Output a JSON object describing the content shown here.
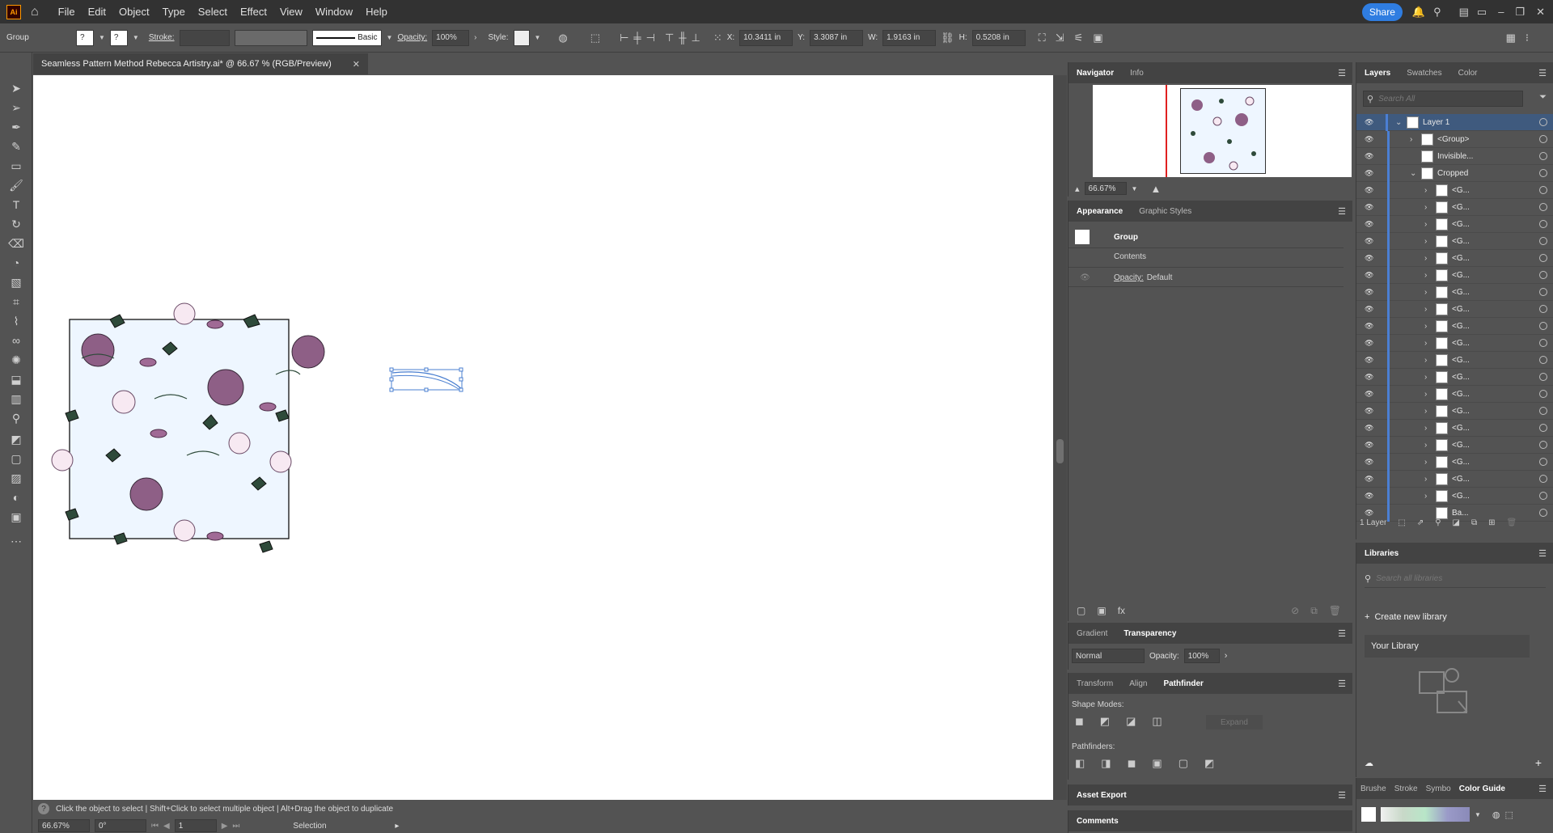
{
  "app": {
    "logo": "Ai",
    "accent": "#2f7de1",
    "logo_color": "#ff9a00",
    "logo_bg": "#330000"
  },
  "menu": [
    "File",
    "Edit",
    "Object",
    "Type",
    "Select",
    "Effect",
    "View",
    "Window",
    "Help"
  ],
  "top_right": {
    "share": "Share"
  },
  "control": {
    "selection_type": "Group",
    "stroke_label": "Stroke:",
    "brush_label": "Basic",
    "opacity_label": "Opacity:",
    "opacity_value": "100%",
    "style_label": "Style:",
    "x_label": "X:",
    "x_value": "10.3411 in",
    "y_label": "Y:",
    "y_value": "3.3087 in",
    "w_label": "W:",
    "w_value": "1.9163 in",
    "h_label": "H:",
    "h_value": "0.5208 in"
  },
  "document": {
    "tab_title": "Seamless Pattern Method Rebecca Artistry.ai* @ 66.67 % (RGB/Preview)"
  },
  "status": {
    "hint": "Click the object to select  |  Shift+Click to select multiple object  |  Alt+Drag the object to duplicate",
    "zoom": "66.67%",
    "rotate": "0°",
    "artboard": "1",
    "tool": "Selection"
  },
  "navigator": {
    "tabs": [
      "Navigator",
      "Info"
    ],
    "zoom": "66.67%"
  },
  "appearance": {
    "tabs": [
      "Appearance",
      "Graphic Styles"
    ],
    "object": "Group",
    "contents": "Contents",
    "opacity_label": "Opacity:",
    "opacity_value": "Default"
  },
  "transparency": {
    "tabs": [
      "Gradient",
      "Transparency"
    ],
    "mode": "Normal",
    "opacity_label": "Opacity:",
    "opacity_value": "100%"
  },
  "pathfinder": {
    "tabs": [
      "Transform",
      "Align",
      "Pathfinder"
    ],
    "shape_modes": "Shape Modes:",
    "expand": "Expand",
    "pathfinders": "Pathfinders:"
  },
  "asset_export": "Asset Export",
  "comments": "Comments",
  "layers": {
    "tabs": [
      "Layers",
      "Swatches",
      "Color"
    ],
    "search_placeholder": "Search All",
    "rows": [
      {
        "name": "Layer 1",
        "level": 0,
        "expanded": true
      },
      {
        "name": "<Group>",
        "level": 1,
        "expanded": false
      },
      {
        "name": "Invisible...",
        "level": 1,
        "expanded": null
      },
      {
        "name": "Cropped",
        "level": 1,
        "expanded": true
      },
      {
        "name": "<G...",
        "level": 2,
        "expanded": false
      },
      {
        "name": "<G...",
        "level": 2,
        "expanded": false
      },
      {
        "name": "<G...",
        "level": 2,
        "expanded": false
      },
      {
        "name": "<G...",
        "level": 2,
        "expanded": false
      },
      {
        "name": "<G...",
        "level": 2,
        "expanded": false
      },
      {
        "name": "<G...",
        "level": 2,
        "expanded": false
      },
      {
        "name": "<G...",
        "level": 2,
        "expanded": false
      },
      {
        "name": "<G...",
        "level": 2,
        "expanded": false
      },
      {
        "name": "<G...",
        "level": 2,
        "expanded": false
      },
      {
        "name": "<G...",
        "level": 2,
        "expanded": false
      },
      {
        "name": "<G...",
        "level": 2,
        "expanded": false
      },
      {
        "name": "<G...",
        "level": 2,
        "expanded": false
      },
      {
        "name": "<G...",
        "level": 2,
        "expanded": false
      },
      {
        "name": "<G...",
        "level": 2,
        "expanded": false
      },
      {
        "name": "<G...",
        "level": 2,
        "expanded": false
      },
      {
        "name": "<G...",
        "level": 2,
        "expanded": false
      },
      {
        "name": "<G...",
        "level": 2,
        "expanded": false
      },
      {
        "name": "<G...",
        "level": 2,
        "expanded": false
      },
      {
        "name": "<G...",
        "level": 2,
        "expanded": false
      },
      {
        "name": "Ba...",
        "level": 2,
        "expanded": null
      }
    ],
    "count": "1 Layer"
  },
  "libraries": {
    "title": "Libraries",
    "search_placeholder": "Search all libraries",
    "create": "Create new library",
    "your_library": "Your Library"
  },
  "bottom_tabs": [
    "Brushe",
    "Stroke",
    "Symbo",
    "Color Guide"
  ]
}
